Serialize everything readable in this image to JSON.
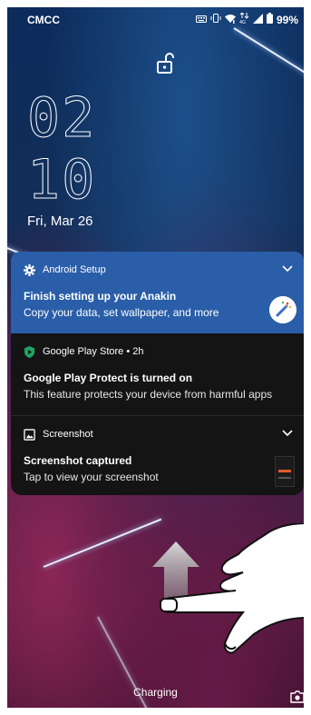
{
  "status_bar": {
    "carrier": "CMCC",
    "battery": "99%",
    "icons": [
      "keyboard-icon",
      "vibrate-icon",
      "wifi-icon",
      "data-icon",
      "signal-icon",
      "battery-icon"
    ]
  },
  "lockscreen": {
    "lock_icon": "unlock-icon",
    "clock_hours": "02",
    "clock_minutes": "10",
    "date": "Fri, Mar 26"
  },
  "notifications": [
    {
      "app": "Android Setup",
      "icon": "gear-icon",
      "title": "Finish setting up your Anakin",
      "text": "Copy your data, set wallpaper, and more",
      "accent": "#2a5ea8"
    },
    {
      "app": "Google Play Store • 2h",
      "icon": "play-protect-icon",
      "title": "Google Play Protect is turned on",
      "text": "This feature protects your device from harmful apps"
    },
    {
      "app": "Screenshot",
      "icon": "image-icon",
      "title": "Screenshot captured",
      "text": "Tap to view your screenshot"
    }
  ],
  "bottom": {
    "charging_label": "Charging",
    "camera_icon": "camera-icon"
  }
}
